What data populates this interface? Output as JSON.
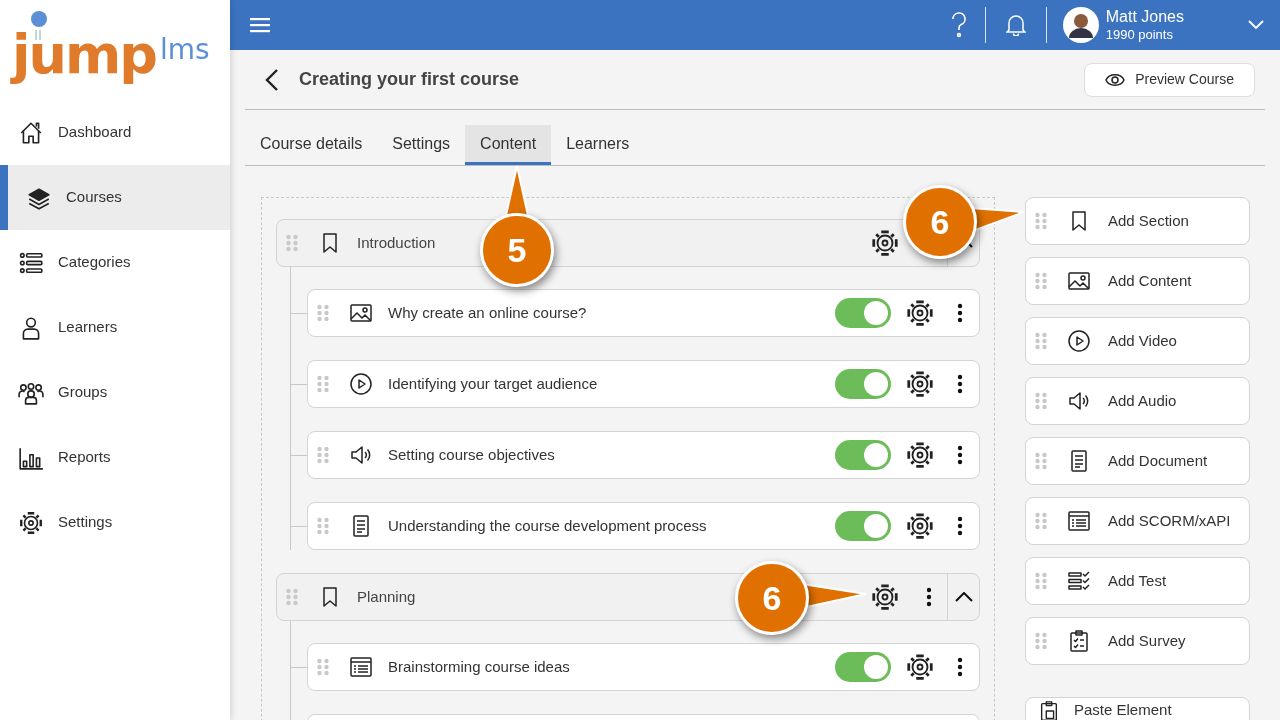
{
  "logo": {
    "primary": "jump",
    "secondary": "lms"
  },
  "sidebar": {
    "items": [
      {
        "label": "Dashboard",
        "kind": "home",
        "selected": false
      },
      {
        "label": "Courses",
        "kind": "books",
        "selected": true
      },
      {
        "label": "Categories",
        "kind": "list",
        "selected": false
      },
      {
        "label": "Learners",
        "kind": "person",
        "selected": false
      },
      {
        "label": "Groups",
        "kind": "group",
        "selected": false
      },
      {
        "label": "Reports",
        "kind": "chart",
        "selected": false
      },
      {
        "label": "Settings",
        "kind": "gear",
        "selected": false
      }
    ]
  },
  "header": {
    "user": {
      "name": "Matt Jones",
      "points": "1990 points"
    }
  },
  "page": {
    "title": "Creating your first course",
    "preview_button": "Preview Course"
  },
  "tabs": [
    {
      "label": "Course details",
      "selected": false
    },
    {
      "label": "Settings",
      "selected": false
    },
    {
      "label": "Content",
      "selected": true
    },
    {
      "label": "Learners",
      "selected": false
    }
  ],
  "sections": [
    {
      "title": "Introduction",
      "items": [
        {
          "title": "Why create an online course?",
          "kind": "image",
          "on": true
        },
        {
          "title": "Identifying your target audience",
          "kind": "video",
          "on": true
        },
        {
          "title": "Setting course objectives",
          "kind": "audio",
          "on": true
        },
        {
          "title": "Understanding the course development process",
          "kind": "document",
          "on": true
        }
      ]
    },
    {
      "title": "Planning",
      "items": [
        {
          "title": "Brainstorming course ideas",
          "kind": "scorm",
          "on": true
        }
      ]
    }
  ],
  "add_panel": {
    "items": [
      {
        "label": "Add Section",
        "kind": "section"
      },
      {
        "label": "Add Content",
        "kind": "image"
      },
      {
        "label": "Add Video",
        "kind": "video"
      },
      {
        "label": "Add Audio",
        "kind": "audio"
      },
      {
        "label": "Add Document",
        "kind": "document"
      },
      {
        "label": "Add SCORM/xAPI",
        "kind": "scorm"
      },
      {
        "label": "Add Test",
        "kind": "test"
      },
      {
        "label": "Add Survey",
        "kind": "survey"
      }
    ],
    "paste": {
      "label": "Paste Element"
    }
  },
  "callouts": [
    {
      "label": "5"
    },
    {
      "label": "6"
    },
    {
      "label": "6"
    }
  ]
}
